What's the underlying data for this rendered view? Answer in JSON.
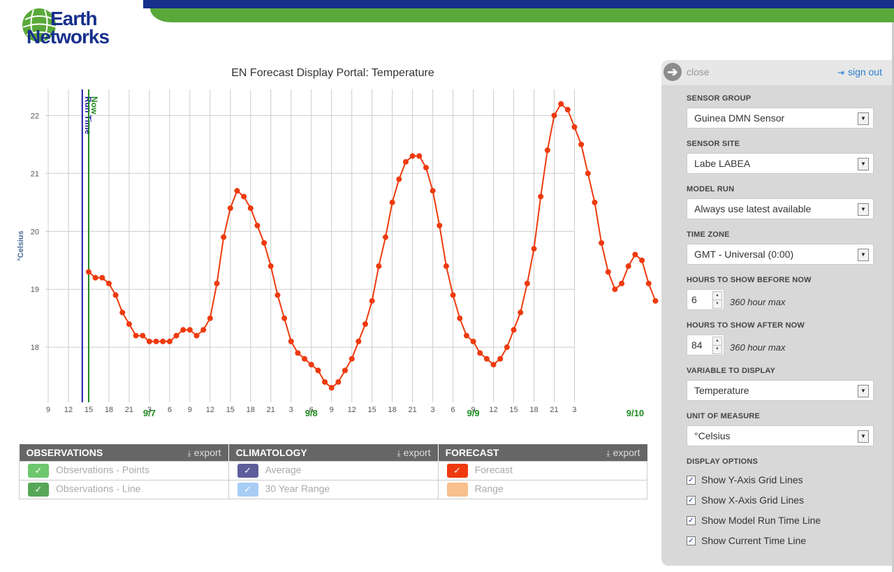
{
  "header": {
    "logo_line1": "Earth",
    "logo_line2": "Networks",
    "colors": {
      "blue": "#17308c",
      "green": "#5aa83a"
    }
  },
  "chart_data": {
    "type": "line",
    "title": "EN Forecast Display Portal: Temperature",
    "ylabel": "°Celsius",
    "xlabel": "",
    "ylim": [
      17.05,
      22.45
    ],
    "yticks": [
      18,
      19,
      20,
      21,
      22
    ],
    "hour_tick_labels": [
      "9",
      "12",
      "15",
      "18",
      "21",
      "3",
      "6",
      "9",
      "12",
      "15",
      "18",
      "21",
      "3",
      "6",
      "9",
      "12",
      "15",
      "18",
      "21",
      "3",
      "6",
      "9",
      "12",
      "15",
      "18",
      "21",
      "3"
    ],
    "date_labels": [
      {
        "label": "9/7",
        "hour_offset": 15
      },
      {
        "label": "9/8",
        "hour_offset": 39
      },
      {
        "label": "9/9",
        "hour_offset": 63
      },
      {
        "label": "9/10",
        "hour_offset": 87
      }
    ],
    "grid": {
      "x": true,
      "y": true
    },
    "vertical_lines": [
      {
        "label": "Run Time",
        "hour_offset": 5,
        "color": "#1b1ba8"
      },
      {
        "label": "Now",
        "hour_offset": 6,
        "color": "#1e8a1e"
      }
    ],
    "series": [
      {
        "name": "Forecast",
        "color": "#ee3a0e",
        "hour_offset_start": 6,
        "values": [
          19.3,
          19.2,
          19.2,
          19.1,
          18.9,
          18.6,
          18.4,
          18.2,
          18.2,
          18.1,
          18.1,
          18.1,
          18.1,
          18.2,
          18.3,
          18.3,
          18.2,
          18.3,
          18.5,
          19.1,
          19.9,
          20.4,
          20.7,
          20.6,
          20.4,
          20.1,
          19.8,
          19.4,
          18.9,
          18.5,
          18.1,
          17.9,
          17.8,
          17.7,
          17.6,
          17.4,
          17.3,
          17.4,
          17.6,
          17.8,
          18.1,
          18.4,
          18.8,
          19.4,
          19.9,
          20.5,
          20.9,
          21.2,
          21.3,
          21.3,
          21.1,
          20.7,
          20.1,
          19.4,
          18.9,
          18.5,
          18.2,
          18.1,
          17.9,
          17.8,
          17.7,
          17.8,
          18.0,
          18.3,
          18.6,
          19.1,
          19.7,
          20.6,
          21.4,
          22.0,
          22.2,
          22.1,
          21.8,
          21.5,
          21.0,
          20.5,
          19.8,
          19.3,
          19.0,
          19.1,
          19.4,
          19.6,
          19.5,
          19.1,
          18.8
        ]
      }
    ]
  },
  "legend": {
    "export_label": "export",
    "observations": {
      "title": "OBSERVATIONS",
      "points": "Observations - Points",
      "line": "Observations - Line"
    },
    "climatology": {
      "title": "CLIMATOLOGY",
      "average": "Average",
      "range": "30 Year Range"
    },
    "forecast": {
      "title": "FORECAST",
      "forecast": "Forecast",
      "range": "Range"
    },
    "colors": {
      "obs_points": "#3db53d",
      "obs_line": "#208a20",
      "clim_avg": "#28287a",
      "clim_range": "#a8cdf5",
      "fc": "#ee3a0e",
      "fc_range": "#f7c08c"
    }
  },
  "panel": {
    "close": "close",
    "sign_out": "sign out",
    "sensor_group": {
      "label": "SENSOR GROUP",
      "value": "Guinea DMN Sensor"
    },
    "sensor_site": {
      "label": "SENSOR SITE",
      "value": "Labe LABEA"
    },
    "model_run": {
      "label": "MODEL RUN",
      "value": "Always use latest available"
    },
    "time_zone": {
      "label": "TIME ZONE",
      "value": "GMT - Universal (0:00)"
    },
    "hours_before": {
      "label": "HOURS TO SHOW BEFORE NOW",
      "value": "6",
      "note": "360 hour max"
    },
    "hours_after": {
      "label": "HOURS TO SHOW AFTER NOW",
      "value": "84",
      "note": "360 hour max"
    },
    "variable": {
      "label": "VARIABLE TO DISPLAY",
      "value": "Temperature"
    },
    "unit": {
      "label": "UNIT OF MEASURE",
      "value": "°Celsius"
    },
    "display_options": {
      "label": "DISPLAY OPTIONS",
      "y_grid": "Show Y-Axis Grid Lines",
      "x_grid": "Show X-Axis Grid Lines",
      "model_run_line": "Show Model Run Time Line",
      "current_time_line": "Show Current Time Line"
    }
  }
}
